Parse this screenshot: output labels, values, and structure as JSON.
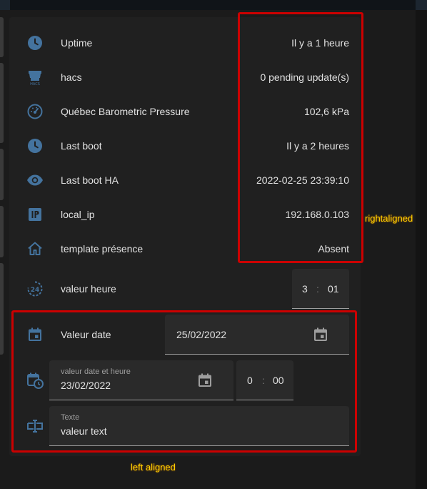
{
  "rows": [
    {
      "label": "Uptime",
      "value": "Il y a 1 heure",
      "icon": "clock-icon"
    },
    {
      "label": "hacs",
      "value": "0 pending update(s)",
      "icon": "hacs-icon"
    },
    {
      "label": "Québec Barometric Pressure",
      "value": "102,6 kPa",
      "icon": "gauge-icon"
    },
    {
      "label": "Last boot",
      "value": "Il y a 2 heures",
      "icon": "clock-icon"
    },
    {
      "label": "Last boot HA",
      "value": "2022-02-25 23:39:10",
      "icon": "eye-icon"
    },
    {
      "label": "local_ip",
      "value": "192.168.0.103",
      "icon": "ip-icon"
    },
    {
      "label": "template présence",
      "value": "Absent",
      "icon": "home-icon"
    }
  ],
  "time_row": {
    "label": "valeur heure",
    "hour": "3",
    "separator": ":",
    "minute": "01",
    "icon": "clock-24-icon"
  },
  "date_row": {
    "label": "Valeur date",
    "value": "25/02/2022",
    "icon": "calendar-icon"
  },
  "datetime_row": {
    "label": "valeur date et heure",
    "date": "23/02/2022",
    "hour": "0",
    "separator": ":",
    "minute": "00",
    "icon": "calendar-clock-icon"
  },
  "text_row": {
    "label": "Texte",
    "value": "valeur text",
    "icon": "text-input-icon"
  },
  "annotations": {
    "right": "rightaligned",
    "left": "left aligned"
  },
  "colors": {
    "icon": "#44739e",
    "card": "#202020",
    "annotation_box": "#cc0000",
    "annotation_text": "#ffd400"
  }
}
